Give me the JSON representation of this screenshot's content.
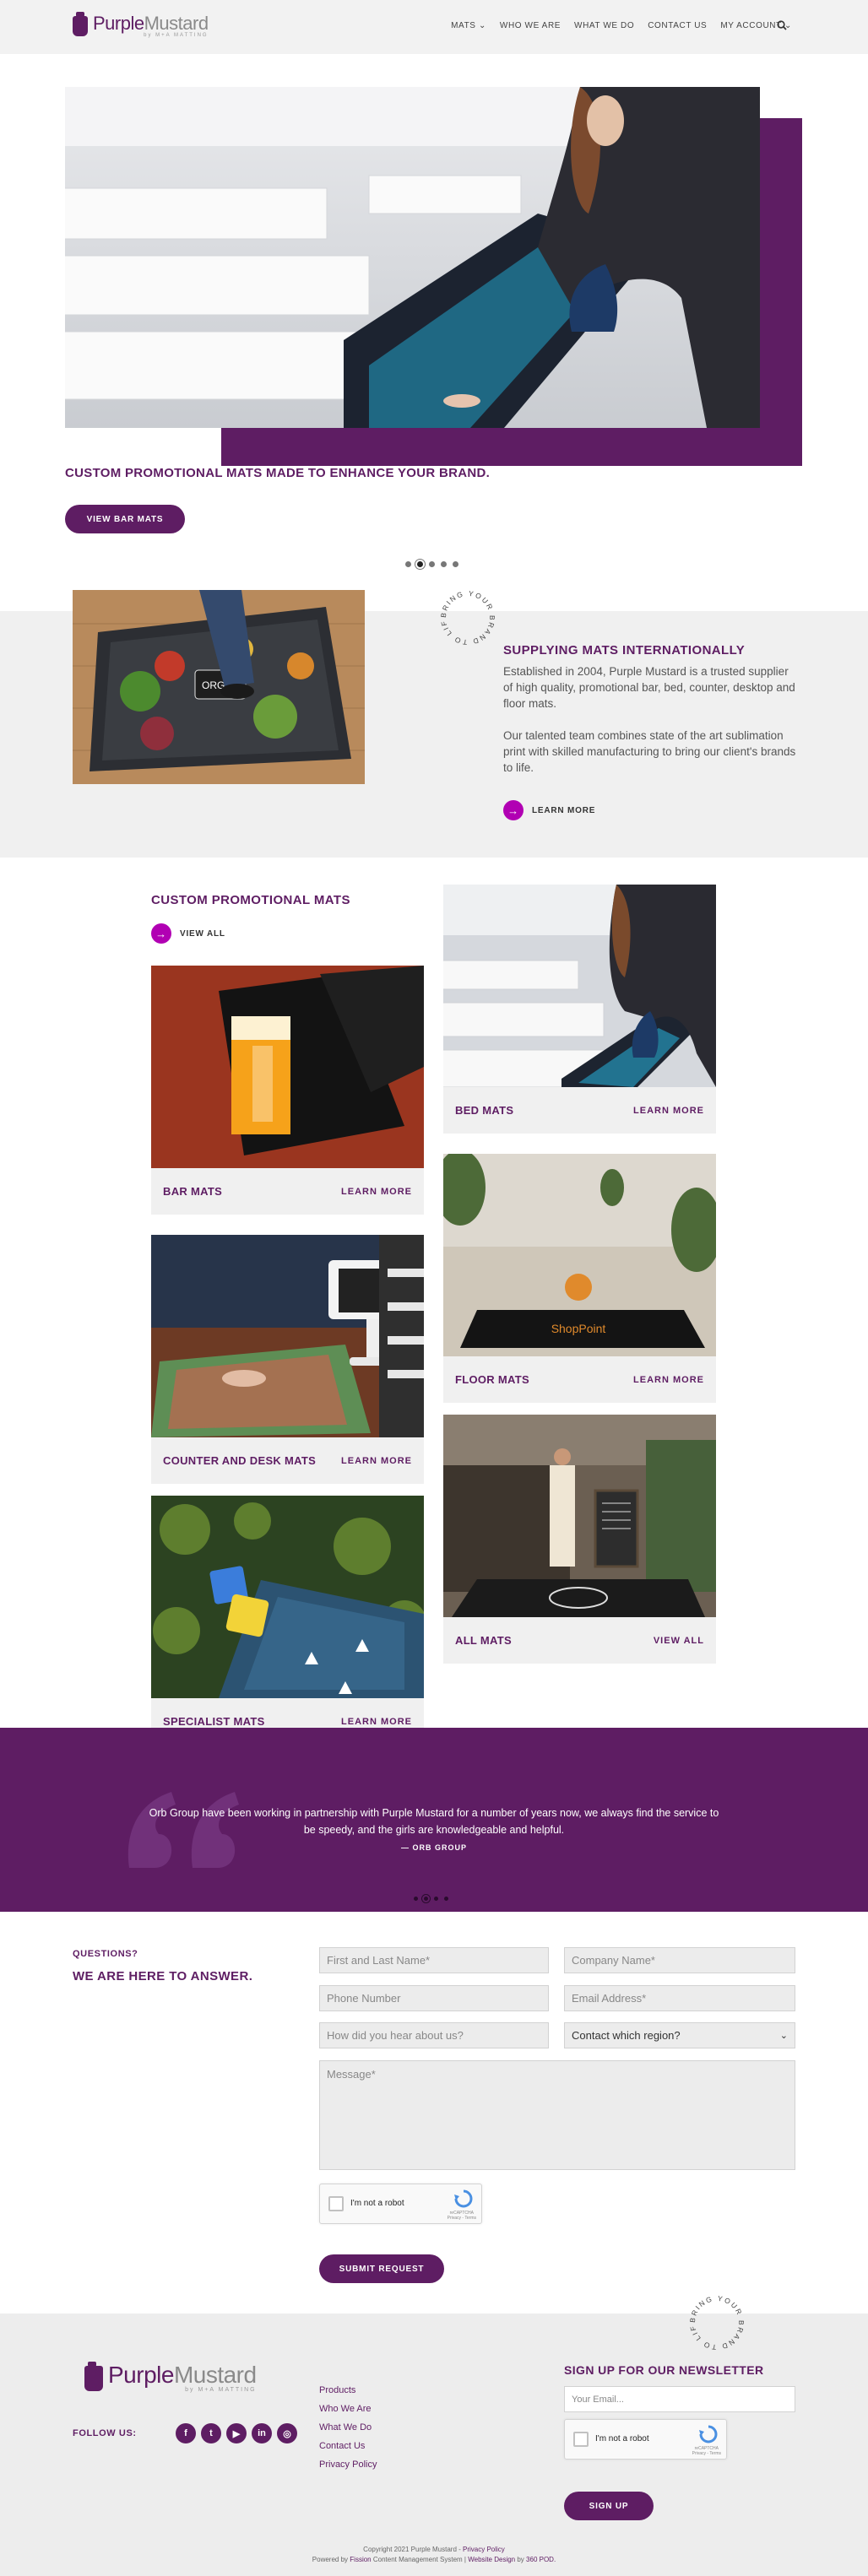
{
  "header": {
    "logo_main": "Purple",
    "logo_second": "Mustard",
    "logo_sub": "by M+A MATTING",
    "nav": [
      {
        "label": "MATS",
        "has_caret": true
      },
      {
        "label": "WHO WE ARE",
        "has_caret": false
      },
      {
        "label": "WHAT WE DO",
        "has_caret": false
      },
      {
        "label": "CONTACT US",
        "has_caret": false
      },
      {
        "label": "MY ACCOUNT",
        "has_caret": true
      }
    ]
  },
  "hero": {
    "title": "CUSTOM PROMOTIONAL MATS MADE TO ENHANCE YOUR BRAND.",
    "button": "VIEW BAR MATS",
    "slide_count": 5,
    "active_slide": 2
  },
  "intro": {
    "badge_text": "BRING YOUR BRAND TO LIFE",
    "heading": "SUPPLYING MATS INTERNATIONALLY",
    "p1": "Established in 2004, Purple Mustard is a trusted supplier of high quality, promotional bar, bed, counter, desktop and floor mats.",
    "p2": "Our talented team combines state of the art sublimation print with skilled manufacturing to bring our client's brands to life.",
    "link": "LEARN MORE"
  },
  "products": {
    "heading": "CUSTOM PROMOTIONAL MATS",
    "view_all": "VIEW ALL",
    "cards": [
      {
        "title": "BED MATS",
        "link": "LEARN MORE"
      },
      {
        "title": "BAR MATS",
        "link": "LEARN MORE"
      },
      {
        "title": "FLOOR MATS",
        "link": "LEARN MORE"
      },
      {
        "title": "COUNTER AND DESK MATS",
        "link": "LEARN MORE"
      },
      {
        "title": "ALL MATS",
        "link": "VIEW ALL"
      },
      {
        "title": "SPECIALIST MATS",
        "link": "LEARN MORE"
      }
    ],
    "floor_logo": "ShopPoint"
  },
  "testimonial": {
    "line1": "Orb Group have been working in partnership with Purple Mustard for a number of years now, we always find the service to",
    "line2": "be speedy, and the girls are knowledgeable and helpful.",
    "author": "— ORB GROUP",
    "slide_count": 4,
    "active_slide": 2
  },
  "contact": {
    "kicker": "QUESTIONS?",
    "heading": "WE ARE HERE TO ANSWER.",
    "name_ph": "First and Last Name*",
    "company_ph": "Company Name*",
    "phone_ph": "Phone Number",
    "email_ph": "Email Address*",
    "hear_ph": "How did you hear about us?",
    "region_value": "Contact which region?",
    "message_ph": "Message*",
    "captcha_label": "I'm not a robot",
    "captcha_brand": "reCAPTCHA",
    "captcha_terms": "Privacy - Terms",
    "submit": "SUBMIT REQUEST"
  },
  "footer": {
    "badge_text": "BRING YOUR BRAND TO LIFE",
    "follow": "FOLLOW US:",
    "social": [
      {
        "icon": "facebook-icon",
        "glyph": "f"
      },
      {
        "icon": "twitter-icon",
        "glyph": "t"
      },
      {
        "icon": "youtube-icon",
        "glyph": "▶"
      },
      {
        "icon": "linkedin-icon",
        "glyph": "in"
      },
      {
        "icon": "instagram-icon",
        "glyph": "◎"
      }
    ],
    "links": [
      "Products",
      "Who We Are",
      "What We Do",
      "Contact Us",
      "Privacy Policy"
    ],
    "newsletter_heading": "SIGN UP FOR OUR NEWSLETTER",
    "email_ph": "Your Email...",
    "captcha_label": "I'm not a robot",
    "signup": "SIGN UP",
    "copyright": "Copyright 2021 Purple Mustard",
    "privacy": "Privacy Policy",
    "powered_prefix": "Powered by",
    "powered_cms": "Fission",
    "powered_mid": "Content Management System",
    "powered_design": "Website Design",
    "powered_by": "by",
    "powered_agency": "360 POD."
  },
  "colors": {
    "brand_purple": "#5e1d63",
    "accent_magenta": "#b100b3",
    "panel_grey": "#f0f0f0"
  }
}
